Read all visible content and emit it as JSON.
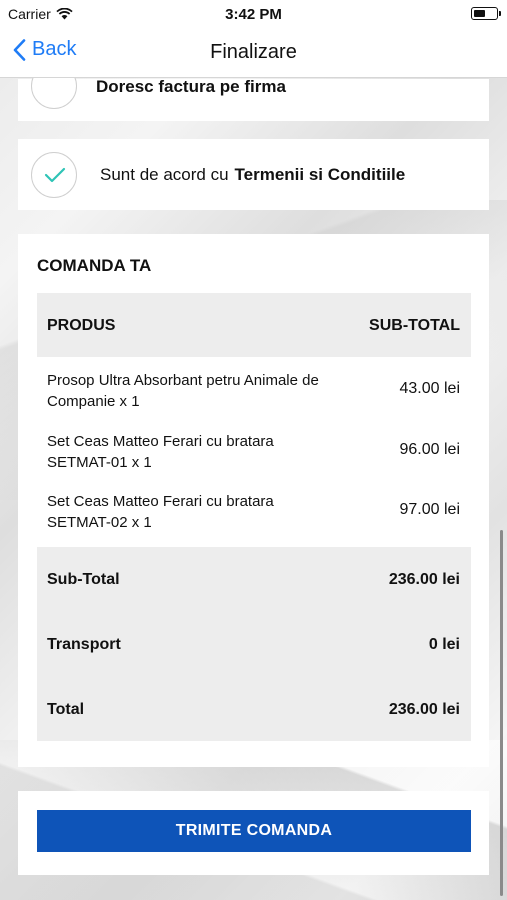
{
  "status_bar": {
    "carrier": "Carrier",
    "time": "3:42 PM",
    "battery_level": 0.55
  },
  "nav": {
    "back_label": "Back",
    "title": "Finalizare"
  },
  "options": {
    "company_invoice": {
      "label": "Doresc factura pe firma",
      "checked": false
    },
    "terms": {
      "prefix": "Sunt de acord cu",
      "link": "Termenii si Conditiile",
      "checked": true
    }
  },
  "order": {
    "title": "COMANDA TA",
    "columns": {
      "product": "PRODUS",
      "subtotal": "SUB-TOTAL"
    },
    "items": [
      {
        "name": "Prosop Ultra Absorbant petru Animale de Companie x 1",
        "price": "43.00 lei"
      },
      {
        "name": "Set Ceas Matteo Ferari cu bratara SETMAT-01 x 1",
        "price": "96.00 lei"
      },
      {
        "name": "Set Ceas Matteo Ferari cu bratara SETMAT-02 x 1",
        "price": "97.00 lei"
      }
    ],
    "totals": [
      {
        "label": "Sub-Total",
        "value": "236.00 lei"
      },
      {
        "label": "Transport",
        "value": "0 lei"
      },
      {
        "label": "Total",
        "value": "236.00 lei"
      }
    ]
  },
  "submit_label": "TRIMITE COMANDA",
  "colors": {
    "accent": "#1f7cf6",
    "button": "#0e54b8",
    "check": "#2ec4b6"
  }
}
